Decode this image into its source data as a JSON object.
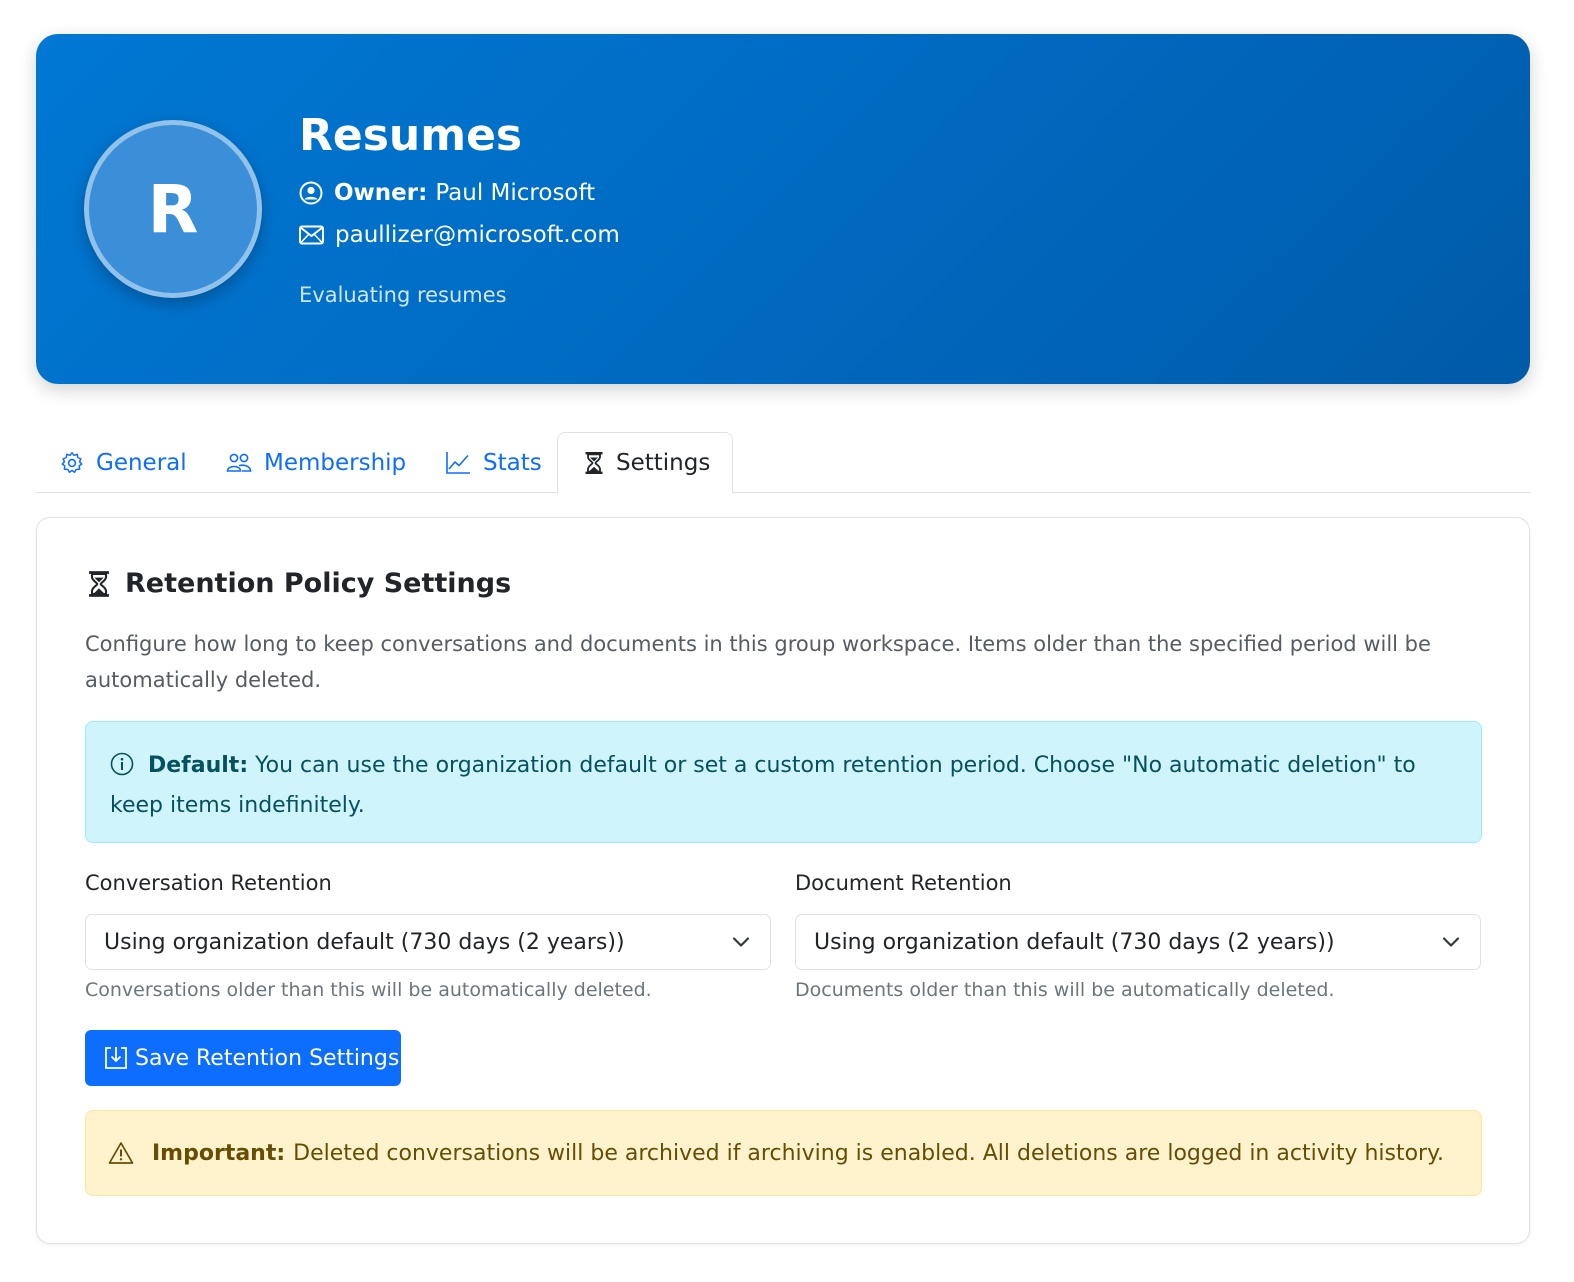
{
  "header": {
    "avatar_letter": "R",
    "title": "Resumes",
    "owner_label": "Owner:",
    "owner_name": "Paul Microsoft",
    "email": "paullizer@microsoft.com",
    "description": "Evaluating resumes"
  },
  "tabs": [
    {
      "label": "General",
      "icon": "gear-icon"
    },
    {
      "label": "Membership",
      "icon": "people-icon"
    },
    {
      "label": "Stats",
      "icon": "graph-icon"
    },
    {
      "label": "Settings",
      "icon": "hourglass-icon",
      "active": true
    }
  ],
  "retention": {
    "title": "Retention Policy Settings",
    "description": "Configure how long to keep conversations and documents in this group workspace. Items older than the specified period will be automatically deleted.",
    "info_label": "Default:",
    "info_text": "You can use the organization default or set a custom retention period. Choose \"No automatic deletion\" to keep items indefinitely.",
    "conversation": {
      "label": "Conversation Retention",
      "selected": "Using organization default (730 days (2 years))",
      "help": "Conversations older than this will be automatically deleted."
    },
    "document": {
      "label": "Document Retention",
      "selected": "Using organization default (730 days (2 years))",
      "help": "Documents older than this will be automatically deleted."
    },
    "save_label": "Save Retention Settings",
    "warning_label": "Important:",
    "warning_text": "Deleted conversations will be archived if archiving is enabled. All deletions are logged in activity history."
  },
  "colors": {
    "hero_start": "#0078d4",
    "hero_end": "#005ba8",
    "link": "#0d6efd",
    "info_bg": "#cff4fc",
    "warning_bg": "#fff3cd"
  }
}
